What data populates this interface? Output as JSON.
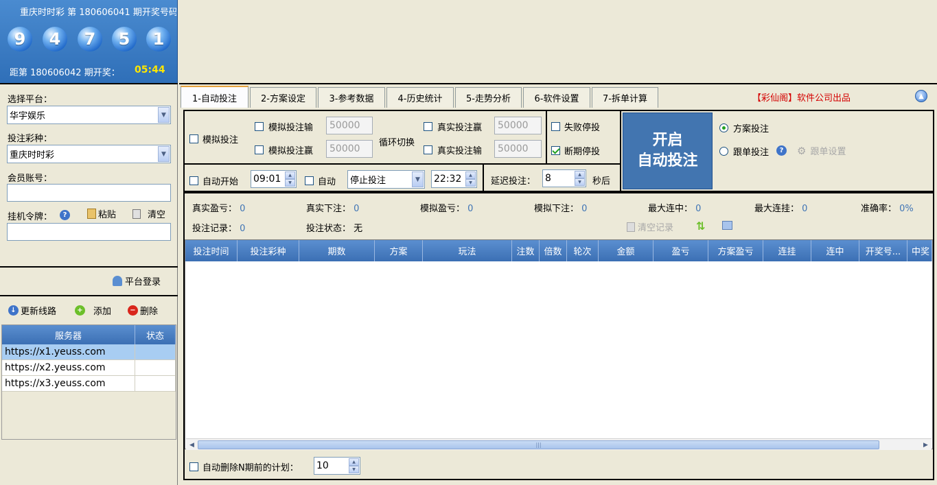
{
  "lottery": {
    "title": "重庆时时彩 第 180606041 期开奖号码",
    "balls": [
      "9",
      "4",
      "7",
      "5",
      "1"
    ],
    "countdown_label": "距第 180606042 期开奖：",
    "countdown_time": "05:44"
  },
  "sidebar": {
    "platform_label": "选择平台：",
    "platform_value": "华宇娱乐",
    "lottery_label": "投注彩种：",
    "lottery_value": "重庆时时彩",
    "account_label": "会员账号：",
    "account_value": "",
    "token_label": "挂机令牌：",
    "paste_label": "粘贴",
    "clear_label": "清空",
    "token_value": "",
    "login_label": "平台登录",
    "update_route_label": "更新线路",
    "add_label": "添加",
    "delete_label": "删除",
    "server_headers": [
      "服务器",
      "状态"
    ],
    "servers": [
      {
        "url": "https://x1.yeuss.com",
        "status": ""
      },
      {
        "url": "https://x2.yeuss.com",
        "status": ""
      },
      {
        "url": "https://x3.yeuss.com",
        "status": ""
      }
    ]
  },
  "tabs": [
    {
      "label": "1-自动投注"
    },
    {
      "label": "2-方案设定"
    },
    {
      "label": "3-参考数据"
    },
    {
      "label": "4-历史统计"
    },
    {
      "label": "5-走势分析"
    },
    {
      "label": "6-软件设置"
    },
    {
      "label": "7-拆单计算"
    }
  ],
  "company": "【彩仙阁】软件公司出品",
  "controls": {
    "sim_bet": "模拟投注",
    "sim_lose": "模拟投注输",
    "sim_win": "模拟投注赢",
    "sim_lose_value": "50000",
    "sim_win_value": "50000",
    "cycle_switch": "循环切换",
    "real_win": "真实投注赢",
    "real_lose": "真实投注输",
    "real_win_value": "50000",
    "real_lose_value": "50000",
    "fail_stop": "失败停投",
    "break_stop": "断期停投",
    "auto_start": "自动开始",
    "start_time": "09:01",
    "auto": "自动",
    "auto_action": "停止投注",
    "end_time": "22:32",
    "delay_label": "延迟投注：",
    "delay_value": "8",
    "delay_unit": "秒后",
    "start_btn_line1": "开启",
    "start_btn_line2": "自动投注",
    "plan_bet": "方案投注",
    "follow_bet": "跟单投注",
    "follow_settings": "跟单设置"
  },
  "stats": {
    "real_profit_label": "真实盈亏：",
    "real_profit": "0",
    "real_bets_label": "真实下注：",
    "real_bets": "0",
    "sim_profit_label": "模拟盈亏：",
    "sim_profit": "0",
    "sim_bets_label": "模拟下注：",
    "sim_bets": "0",
    "max_win_streak_label": "最大连中：",
    "max_win_streak": "0",
    "max_lose_streak_label": "最大连挂：",
    "max_lose_streak": "0",
    "accuracy_label": "准确率：",
    "accuracy": "0%",
    "records_label": "投注记录：",
    "records": "0",
    "status_label": "投注状态：",
    "status": "无",
    "clear_records": "清空记录"
  },
  "grid": {
    "headers": [
      "投注时间",
      "投注彩种",
      "期数",
      "方案",
      "玩法",
      "注数",
      "倍数",
      "轮次",
      "金额",
      "盈亏",
      "方案盈亏",
      "连挂",
      "连中",
      "开奖号...",
      "中奖"
    ]
  },
  "footer": {
    "auto_delete_label": "自动删除N期前的计划：",
    "auto_delete_value": "10"
  }
}
